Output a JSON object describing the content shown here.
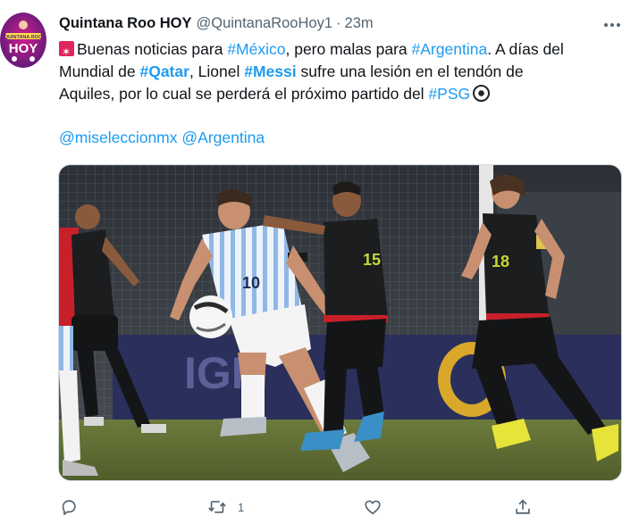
{
  "tweet": {
    "author": {
      "display_name": "Quintana Roo HOY",
      "handle": "@QuintanaRooHoy1",
      "avatar_text": "HOY",
      "avatar_subtext": "QUINTANA ROO"
    },
    "separator": "·",
    "time": "23m",
    "text": {
      "line1_a": "Buenas noticias para ",
      "line1_link1": "#México",
      "line1_b": ", pero malas para ",
      "line1_link2": "#Argentina",
      "line1_c": ". A días del",
      "line2_a": "Mundial de ",
      "line2_link1": "#Qatar",
      "line2_b": ", Lionel ",
      "line2_link2": "#Messi",
      "line2_c": " sufre una lesión en el tendón de",
      "line3_a": "Aquiles, por lo cual se perderá el próximo partido del ",
      "line3_link": "#PSG"
    },
    "mentions": [
      "@miseleccionmx",
      "@Argentina"
    ],
    "media": {
      "jersey_number_white": "10",
      "jersey_number_black_1": "15",
      "jersey_number_black_2": "18",
      "board_text": "IGH"
    },
    "actions": {
      "reply_count": "",
      "retweet_count": "1",
      "like_count": ""
    },
    "colors": {
      "link": "#1d9bf0",
      "secondary_text": "#536471",
      "primary_text": "#0f1419"
    }
  }
}
